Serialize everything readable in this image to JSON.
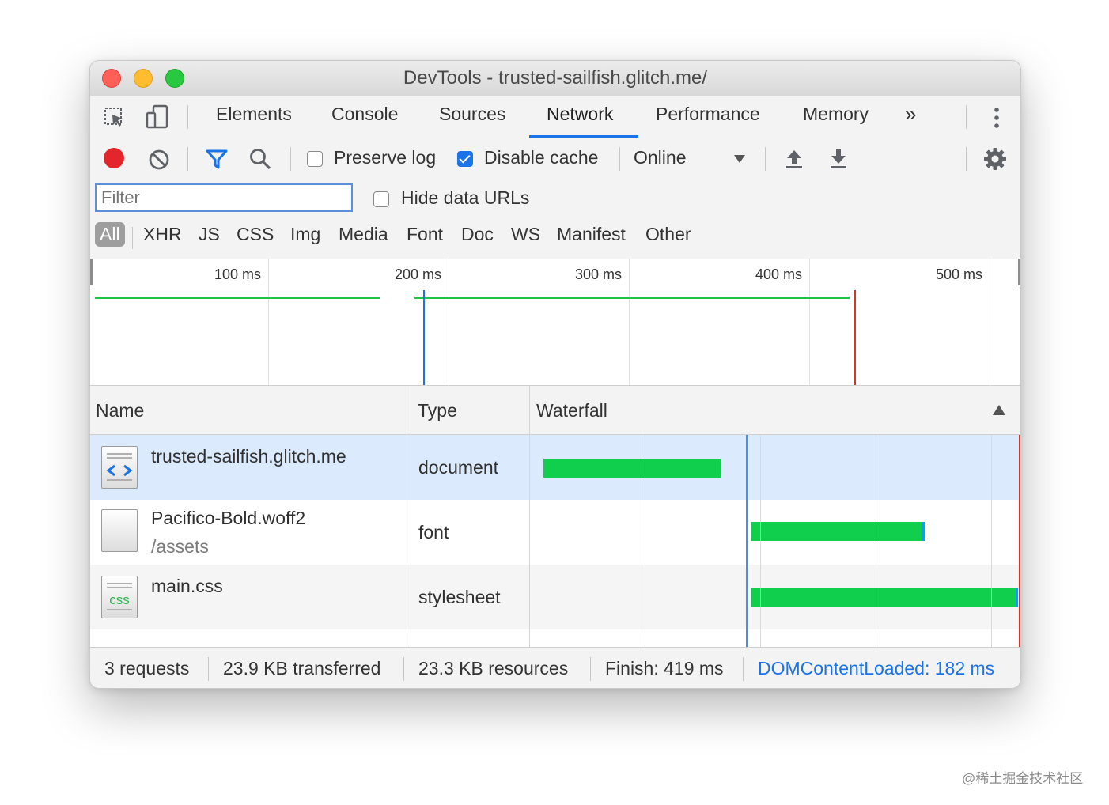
{
  "window": {
    "title": "DevTools - trusted-sailfish.glitch.me/"
  },
  "tabs": [
    {
      "label": "Elements"
    },
    {
      "label": "Console"
    },
    {
      "label": "Sources"
    },
    {
      "label": "Network",
      "active": true
    },
    {
      "label": "Performance"
    },
    {
      "label": "Memory"
    }
  ],
  "tabs_more_glyph": "»",
  "toolbar": {
    "preserve_log_label": "Preserve log",
    "preserve_log_checked": false,
    "disable_cache_label": "Disable cache",
    "disable_cache_checked": true,
    "throttling_value": "Online"
  },
  "filter": {
    "placeholder": "Filter",
    "value": "",
    "hide_data_urls_label": "Hide data URLs",
    "hide_data_urls_checked": false,
    "types": [
      "All",
      "XHR",
      "JS",
      "CSS",
      "Img",
      "Media",
      "Font",
      "Doc",
      "WS",
      "Manifest",
      "Other"
    ],
    "active_type": "All"
  },
  "overview": {
    "ticks": [
      "100 ms",
      "200 ms",
      "300 ms",
      "400 ms",
      "500 ms"
    ]
  },
  "table": {
    "headers": {
      "name": "Name",
      "type": "Type",
      "waterfall": "Waterfall"
    },
    "rows": [
      {
        "name": "trusted-sailfish.glitch.me",
        "path": "",
        "type": "document",
        "icon": "html-document-icon",
        "selected": true
      },
      {
        "name": "Pacifico-Bold.woff2",
        "path": "/assets",
        "type": "font",
        "icon": "blank-file-icon"
      },
      {
        "name": "main.css",
        "path": "",
        "type": "stylesheet",
        "icon": "css-file-icon"
      }
    ]
  },
  "status": {
    "requests": "3 requests",
    "transferred": "23.9 KB transferred",
    "resources": "23.3 KB resources",
    "finish": "Finish: 419 ms",
    "dom_content_loaded": "DOMContentLoaded: 182 ms"
  },
  "colors": {
    "accent": "#1a73e8",
    "record": "#e3262b",
    "timing_bar": "#0fcf4c",
    "load_line": "#d93025",
    "dcl_line": "#1a73e8"
  },
  "watermark": "@稀土掘金技术社区"
}
